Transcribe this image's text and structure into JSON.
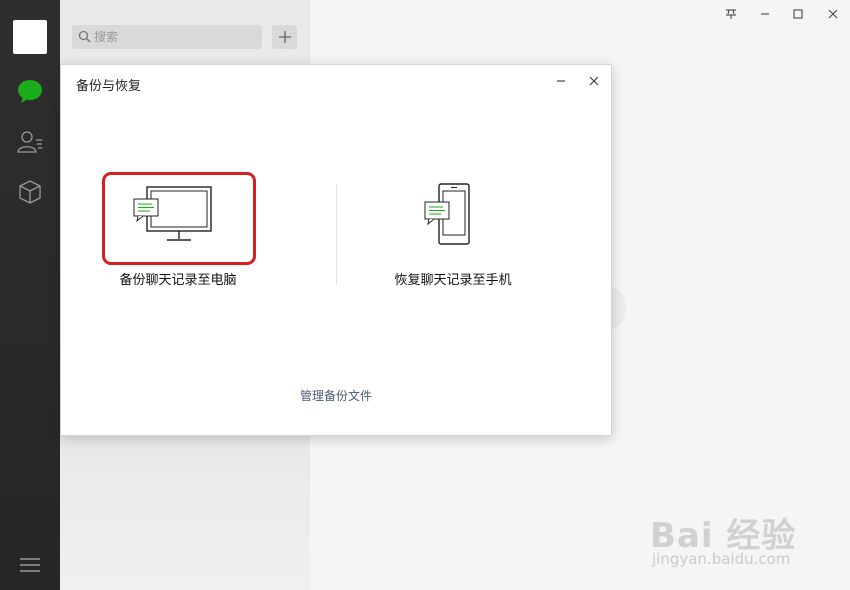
{
  "search": {
    "placeholder": "搜索"
  },
  "dialog": {
    "title": "备份与恢复",
    "backup_label": "备份聊天记录至电脑",
    "restore_label": "恢复聊天记录至手机",
    "manage_link": "管理备份文件"
  },
  "watermark": {
    "main": "Bai 经验",
    "sub": "jingyan.baidu.com"
  },
  "colors": {
    "accent_green": "#1aad19",
    "highlight_red": "#d81e1e"
  }
}
